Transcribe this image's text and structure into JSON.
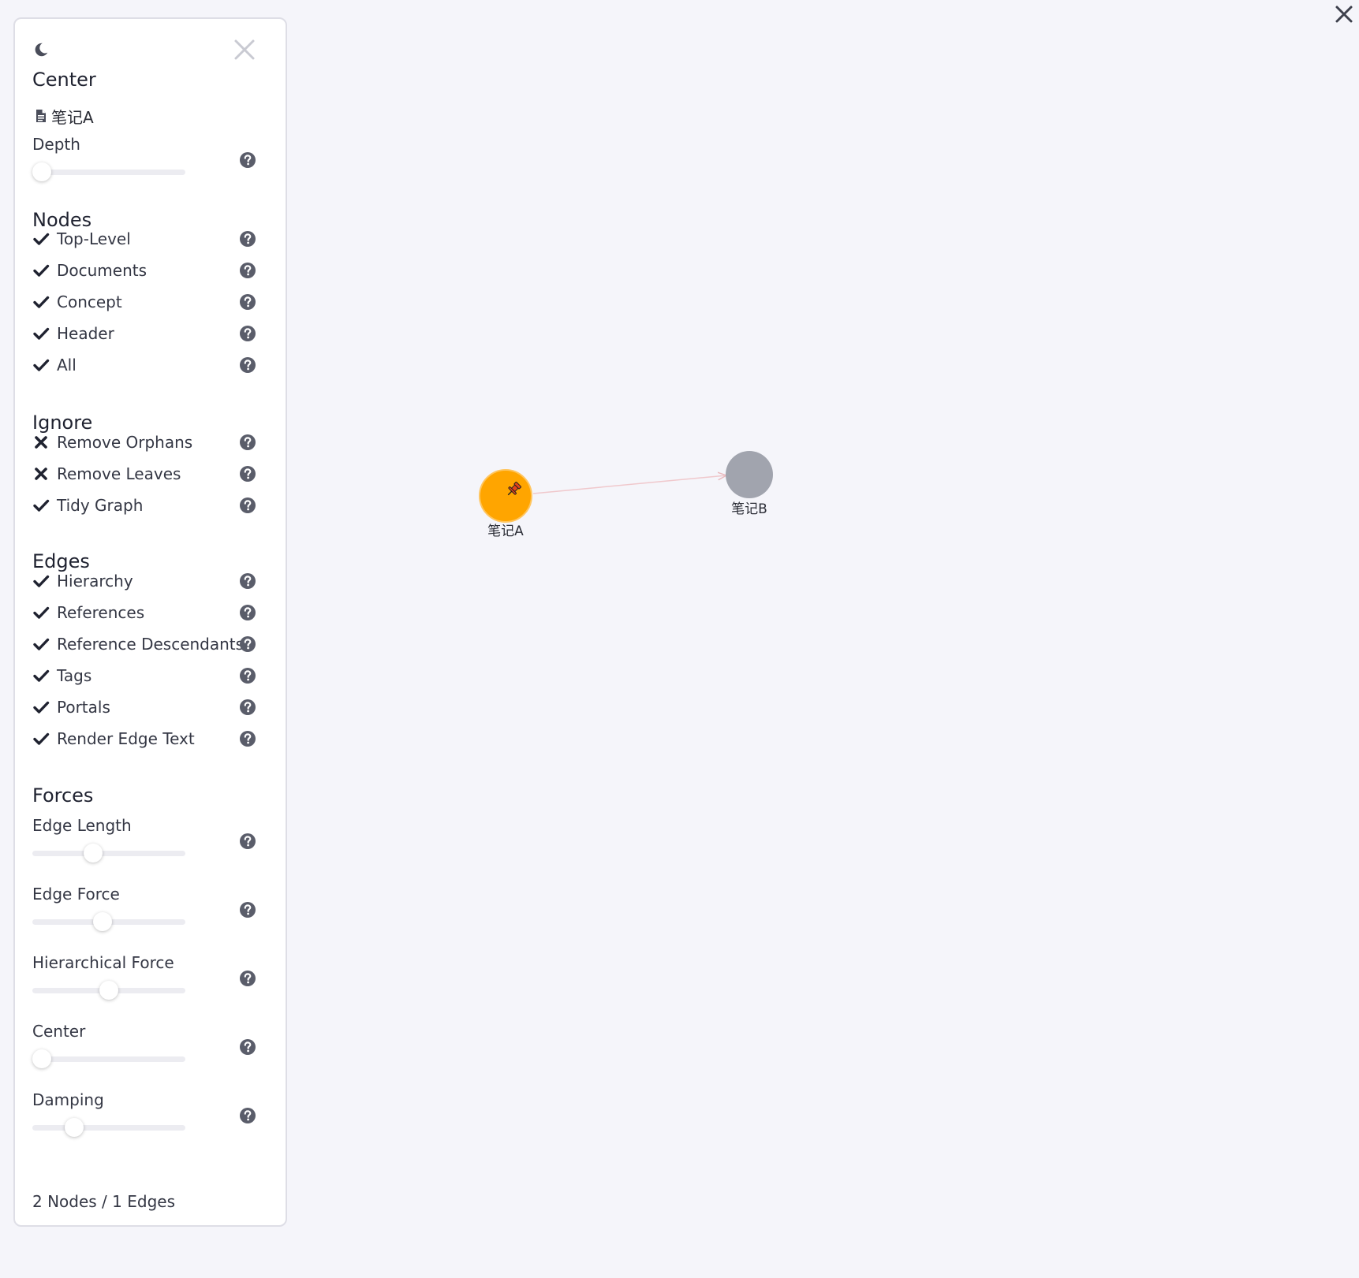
{
  "panel": {
    "center": {
      "title": "Center",
      "document": "笔记A",
      "depth_label": "Depth",
      "depth_value": 0
    },
    "nodes": {
      "title": "Nodes",
      "items": [
        {
          "label": "Top-Level",
          "checked": true
        },
        {
          "label": "Documents",
          "checked": true
        },
        {
          "label": "Concept",
          "checked": true
        },
        {
          "label": "Header",
          "checked": true
        },
        {
          "label": "All",
          "checked": true
        }
      ]
    },
    "ignore": {
      "title": "Ignore",
      "items": [
        {
          "label": "Remove Orphans",
          "checked": false
        },
        {
          "label": "Remove Leaves",
          "checked": false
        },
        {
          "label": "Tidy Graph",
          "checked": true
        }
      ]
    },
    "edges": {
      "title": "Edges",
      "items": [
        {
          "label": "Hierarchy",
          "checked": true
        },
        {
          "label": "References",
          "checked": true
        },
        {
          "label": "Reference Descendants",
          "checked": true
        },
        {
          "label": "Tags",
          "checked": true
        },
        {
          "label": "Portals",
          "checked": true
        },
        {
          "label": "Render Edge Text",
          "checked": true
        }
      ]
    },
    "forces": {
      "title": "Forces",
      "sliders": [
        {
          "label": "Edge Length",
          "level": 0.38
        },
        {
          "label": "Edge Force",
          "level": 0.45
        },
        {
          "label": "Hierarchical Force",
          "level": 0.5
        },
        {
          "label": "Center",
          "level": 0.0
        },
        {
          "label": "Damping",
          "level": 0.24
        }
      ]
    },
    "status": "2 Nodes / 1 Edges"
  },
  "graph": {
    "nodes": [
      {
        "label": "笔记A",
        "color": "#ffa500",
        "pinned": true
      },
      {
        "label": "笔记B",
        "color": "#a1a4ae",
        "pinned": false
      }
    ],
    "edge_color": "#f0c8cc"
  },
  "colors": {
    "background": "#f5f5fa",
    "panel_border": "#dedee6",
    "icon": "#4a4d5a",
    "pinned_node": "#ffa500",
    "default_node": "#a1a4ae"
  },
  "icons": {
    "theme": "moon-icon",
    "close_panel": "close-icon",
    "close_view": "close-icon",
    "help": "question-circle-icon",
    "checked": "check-icon",
    "unchecked": "times-icon",
    "document": "file-icon",
    "pin": "pin-icon"
  }
}
